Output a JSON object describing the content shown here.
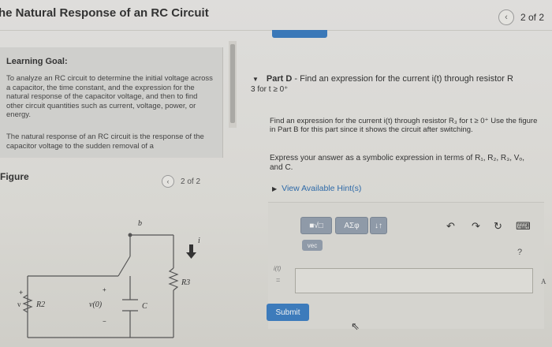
{
  "header": {
    "title": "he Natural Response of an RC Circuit",
    "prev_icon": "chevron-left-icon",
    "page": "2 of 2"
  },
  "goal": {
    "heading": "Learning Goal:",
    "text1": "To analyze an RC circuit to determine the initial voltage across a capacitor, the time constant, and the expression for the natural response of the capacitor voltage, and then to find other circuit quantities such as current, voltage, power, or energy.",
    "text2": "The natural response of an RC circuit is the response of the capacitor voltage to the sudden removal of a"
  },
  "figure": {
    "heading": "Figure",
    "page": "2 of 2",
    "labels": {
      "b": "b",
      "i": "i",
      "R3": "R3",
      "R2": "R2",
      "v0": "v(0)",
      "C": "C",
      "Vs": "v",
      "plus": "+",
      "minus": "−"
    }
  },
  "part": {
    "arrow": "▼",
    "label": "Part D",
    "title": " - Find an expression for the current i(t) through resistor R",
    "title2": "3 for t ≥ 0⁺"
  },
  "question": {
    "p1": "Find an expression for the current i(t) through resistor R₃ for t ≥ 0⁺ Use the figure in Part B for this part since it shows the circuit after switching.",
    "p2": "Express your answer as a symbolic expression in terms of R₁, R₂, R₃, Vₒ, and C."
  },
  "hints": {
    "label": "View Available Hint(s)"
  },
  "toolbar": {
    "template_label": "■√□",
    "greek_label": "ΑΣφ",
    "arrows_label": "↓↑",
    "vec_label": "vec",
    "undo": "↶",
    "redo": "↷",
    "refresh": "↻",
    "keyboard": "⌨",
    "help": "?"
  },
  "answer": {
    "label": "i(t)",
    "eq": "=",
    "value": "",
    "unit": "A"
  },
  "submit": {
    "label": "Submit"
  }
}
